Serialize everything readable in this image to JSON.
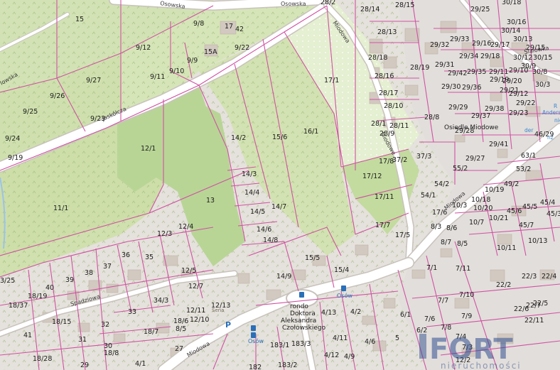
{
  "roads": [
    {
      "id": "osowska",
      "name": "Osowska"
    },
    {
      "id": "miodowa-n",
      "name": "Miodowa"
    },
    {
      "id": "miodowa-e",
      "name": "Miodowa"
    },
    {
      "id": "miodowa-s",
      "name": "Miodowa"
    },
    {
      "id": "jaskolcza",
      "name": "Jaskółcza"
    },
    {
      "id": "spadziowa",
      "name": "Spadziowa"
    },
    {
      "id": "slalowka",
      "name": "Ślalowka"
    },
    {
      "id": "miodowe-ct",
      "name": "Miodowe"
    },
    {
      "id": "lowska",
      "name": "lowska"
    },
    {
      "id": "sena",
      "name": "Sena"
    }
  ],
  "poi": {
    "roundabout": [
      "rondo",
      "Doktora",
      "Aleksandra",
      "Czołowskiego"
    ],
    "bus_stops": [
      "Osów",
      "Osów",
      "Osów",
      "Osów"
    ],
    "parking": "P",
    "osiedle": "Osiedle Miodowe",
    "blue_labels": [
      "Andersen",
      "R",
      "nie",
      "der",
      "nż"
    ]
  },
  "parcels": [
    {
      "id": "15"
    },
    {
      "id": "9/8"
    },
    {
      "id": "17"
    },
    {
      "id": "42"
    },
    {
      "id": "28/2"
    },
    {
      "id": "28/14"
    },
    {
      "id": "28/15"
    },
    {
      "id": "29/25"
    },
    {
      "id": "30/18"
    },
    {
      "id": "30/16"
    },
    {
      "id": "30/14"
    },
    {
      "id": "9/12"
    },
    {
      "id": "15A"
    },
    {
      "id": "9/9"
    },
    {
      "id": "9/22"
    },
    {
      "id": "28/13"
    },
    {
      "id": "29/33"
    },
    {
      "id": "29/16"
    },
    {
      "id": "30/13"
    },
    {
      "id": "30/12"
    },
    {
      "id": "9/27"
    },
    {
      "id": "9/11"
    },
    {
      "id": "9/10"
    },
    {
      "id": "17/1"
    },
    {
      "id": "28/18"
    },
    {
      "id": "28/19"
    },
    {
      "id": "29/32"
    },
    {
      "id": "29/34"
    },
    {
      "id": "29/17"
    },
    {
      "id": "29/15"
    },
    {
      "id": "29/18"
    },
    {
      "id": "30/15"
    },
    {
      "id": "30/9"
    },
    {
      "id": "28/16"
    },
    {
      "id": "29/31"
    },
    {
      "id": "29/42"
    },
    {
      "id": "29/35"
    },
    {
      "id": "29/11"
    },
    {
      "id": "29/10"
    },
    {
      "id": "29/19"
    },
    {
      "id": "29/20"
    },
    {
      "id": "30/8"
    },
    {
      "id": "30/3"
    },
    {
      "id": "9/26"
    },
    {
      "id": "28/17"
    },
    {
      "id": "29/30"
    },
    {
      "id": "29/36"
    },
    {
      "id": "29/12"
    },
    {
      "id": "28/10"
    },
    {
      "id": "29/22"
    },
    {
      "id": "29/21"
    },
    {
      "id": "9/25"
    },
    {
      "id": "29/29"
    },
    {
      "id": "29/38"
    },
    {
      "id": "29/23"
    },
    {
      "id": "28/8"
    },
    {
      "id": "29/37"
    },
    {
      "id": "28/1"
    },
    {
      "id": "28/11"
    },
    {
      "id": "28/9"
    },
    {
      "id": "29/28"
    },
    {
      "id": "46/29"
    },
    {
      "id": "9/23"
    },
    {
      "id": "14/2"
    },
    {
      "id": "15/6"
    },
    {
      "id": "16/1"
    },
    {
      "id": "9/24"
    },
    {
      "id": "29/41"
    },
    {
      "id": "12/1"
    },
    {
      "id": "29/27"
    },
    {
      "id": "63/1"
    },
    {
      "id": "9/19"
    },
    {
      "id": "17/8"
    },
    {
      "id": "37/2"
    },
    {
      "id": "37/3"
    },
    {
      "id": "53/2"
    },
    {
      "id": "55/2"
    },
    {
      "id": "14/3"
    },
    {
      "id": "17/12"
    },
    {
      "id": "54/2"
    },
    {
      "id": "10/19"
    },
    {
      "id": "49/2"
    },
    {
      "id": "14/4"
    },
    {
      "id": "54/1"
    },
    {
      "id": "10/18"
    },
    {
      "id": "13"
    },
    {
      "id": "17/11"
    },
    {
      "id": "10/3"
    },
    {
      "id": "10/20"
    },
    {
      "id": "45/5"
    },
    {
      "id": "45/4"
    },
    {
      "id": "11/1"
    },
    {
      "id": "14/7"
    },
    {
      "id": "17/6"
    },
    {
      "id": "45/6"
    },
    {
      "id": "14/5"
    },
    {
      "id": "10/21"
    },
    {
      "id": "45/3"
    },
    {
      "id": "12/4"
    },
    {
      "id": "17/7"
    },
    {
      "id": "8/3"
    },
    {
      "id": "10/7"
    },
    {
      "id": "45/7"
    },
    {
      "id": "12/3"
    },
    {
      "id": "14/6"
    },
    {
      "id": "8/6"
    },
    {
      "id": "17/5"
    },
    {
      "id": "14/8"
    },
    {
      "id": "8/7"
    },
    {
      "id": "10/13"
    },
    {
      "id": "8/5"
    },
    {
      "id": "10/11"
    },
    {
      "id": "36"
    },
    {
      "id": "35"
    },
    {
      "id": "15/5"
    },
    {
      "id": "37"
    },
    {
      "id": "38"
    },
    {
      "id": "7/1"
    },
    {
      "id": "7/11"
    },
    {
      "id": "12/5"
    },
    {
      "id": "15/4"
    },
    {
      "id": "22/3"
    },
    {
      "id": "22/4"
    },
    {
      "id": "14/9"
    },
    {
      "id": "39"
    },
    {
      "id": "22/2"
    },
    {
      "id": "40"
    },
    {
      "id": "12/7"
    },
    {
      "id": "3/25"
    },
    {
      "id": "18/19"
    },
    {
      "id": "34/3"
    },
    {
      "id": "12/13"
    },
    {
      "id": "7/10"
    },
    {
      "id": "22/7"
    },
    {
      "id": "18/37"
    },
    {
      "id": "33"
    },
    {
      "id": "12/11"
    },
    {
      "id": "4/13"
    },
    {
      "id": "4/2"
    },
    {
      "id": "6/1"
    },
    {
      "id": "7/7"
    },
    {
      "id": "7/9"
    },
    {
      "id": "22/6"
    },
    {
      "id": "22/5"
    },
    {
      "id": "18/15"
    },
    {
      "id": "18/6"
    },
    {
      "id": "12/10"
    },
    {
      "id": "7/6"
    },
    {
      "id": "22/11"
    },
    {
      "id": "32"
    },
    {
      "id": "8/5b"
    },
    {
      "id": "7/8"
    },
    {
      "id": "41"
    },
    {
      "id": "18/7"
    },
    {
      "id": "4/11"
    },
    {
      "id": "4/6"
    },
    {
      "id": "5"
    },
    {
      "id": "6/2"
    },
    {
      "id": "31"
    },
    {
      "id": "183/1"
    },
    {
      "id": "183/3"
    },
    {
      "id": "7/4"
    },
    {
      "id": "18/28"
    },
    {
      "id": "30"
    },
    {
      "id": "18/8"
    },
    {
      "id": "27"
    },
    {
      "id": "4/12"
    },
    {
      "id": "4/9"
    },
    {
      "id": "7/3"
    },
    {
      "id": "29"
    },
    {
      "id": "4/1"
    },
    {
      "id": "182"
    },
    {
      "id": "183/2"
    },
    {
      "id": "12/2"
    }
  ],
  "watermark": {
    "text": "FORT",
    "sub": "nieruchomości"
  }
}
